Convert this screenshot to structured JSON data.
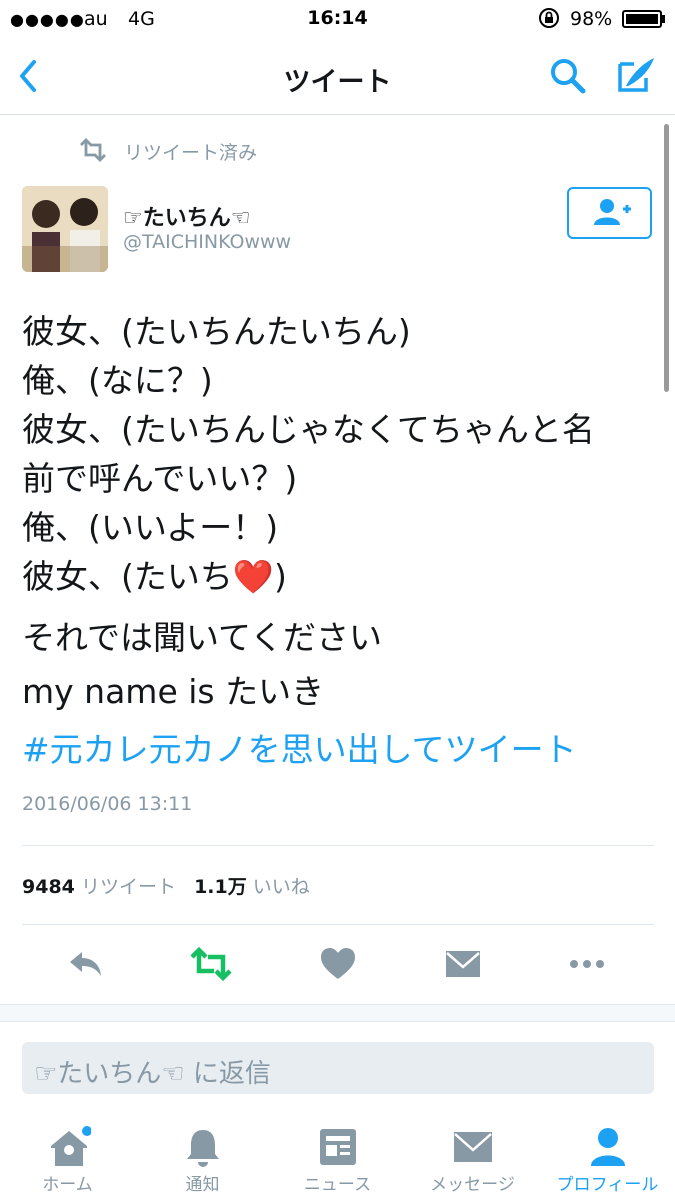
{
  "status": {
    "signal": "●●●●●",
    "carrier": "au",
    "network": "4G",
    "time": "16:14",
    "battery": "98%"
  },
  "nav": {
    "title": "ツイート",
    "back_icon": "chevron-left-icon",
    "search_icon": "search-icon",
    "compose_icon": "compose-icon"
  },
  "tweet": {
    "retweeted_label": "リツイート済み",
    "user_name": "☞たいちん☜",
    "user_handle": "@TAICHINKOwww",
    "lines": [
      "彼女、(たいちんたいちん)",
      "俺、(なに？)",
      "彼女、(たいちんじゃなくてちゃんと名",
      "前で呼んでいい？)",
      "俺、(いいよー！)",
      "彼女、(たいち❤️)",
      "それでは聞いてください",
      "my name is たいき"
    ],
    "hashtag": "#元カレ元カノを思い出してツイート",
    "timestamp": "2016/06/06 13:11",
    "retweet_count": "9484",
    "retweet_label": "リツイート",
    "like_count": "1.1万",
    "like_label": "いいね"
  },
  "reply": {
    "placeholder": "☞たいちん☜ に返信"
  },
  "tabs": [
    {
      "label": "ホーム",
      "icon": "home-icon"
    },
    {
      "label": "通知",
      "icon": "bell-icon"
    },
    {
      "label": "ニュース",
      "icon": "news-icon"
    },
    {
      "label": "メッセージ",
      "icon": "envelope-icon"
    },
    {
      "label": "プロフィール",
      "icon": "person-icon"
    }
  ],
  "colors": {
    "accent": "#1da1f2",
    "retweet_active": "#17bf63",
    "muted": "#8899a6",
    "icon_gray": "#8899a6"
  }
}
